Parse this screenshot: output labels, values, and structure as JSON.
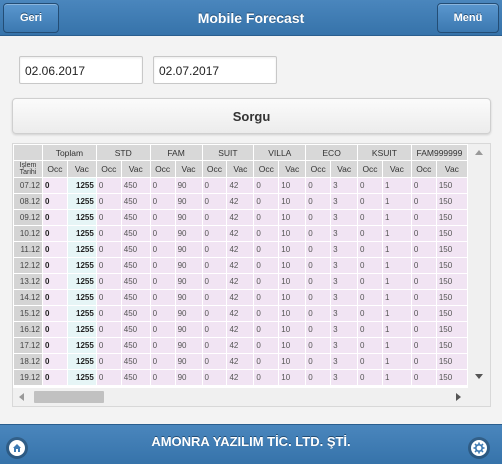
{
  "header": {
    "title": "Mobile Forecast",
    "back_label": "Geri",
    "menu_label": "Menü"
  },
  "filters": {
    "start_date": "02.06.2017",
    "end_date": "02.07.2017",
    "query_label": "Sorgu"
  },
  "grid": {
    "date_header": "İşlem Tarihi",
    "groups": [
      "Toplam",
      "STD",
      "FAM",
      "SUIT",
      "VILLA",
      "ECO",
      "KSUIT",
      "FAM999999"
    ],
    "sub_headers": [
      "Occ",
      "Vac"
    ],
    "rows": [
      {
        "date": "07.12",
        "values": [
          "0",
          "1255",
          "0",
          "450",
          "0",
          "90",
          "0",
          "42",
          "0",
          "10",
          "0",
          "3",
          "0",
          "1",
          "0",
          "150"
        ]
      },
      {
        "date": "08.12",
        "values": [
          "0",
          "1255",
          "0",
          "450",
          "0",
          "90",
          "0",
          "42",
          "0",
          "10",
          "0",
          "3",
          "0",
          "1",
          "0",
          "150"
        ]
      },
      {
        "date": "09.12",
        "values": [
          "0",
          "1255",
          "0",
          "450",
          "0",
          "90",
          "0",
          "42",
          "0",
          "10",
          "0",
          "3",
          "0",
          "1",
          "0",
          "150"
        ]
      },
      {
        "date": "10.12",
        "values": [
          "0",
          "1255",
          "0",
          "450",
          "0",
          "90",
          "0",
          "42",
          "0",
          "10",
          "0",
          "3",
          "0",
          "1",
          "0",
          "150"
        ]
      },
      {
        "date": "11.12",
        "values": [
          "0",
          "1255",
          "0",
          "450",
          "0",
          "90",
          "0",
          "42",
          "0",
          "10",
          "0",
          "3",
          "0",
          "1",
          "0",
          "150"
        ]
      },
      {
        "date": "12.12",
        "values": [
          "0",
          "1255",
          "0",
          "450",
          "0",
          "90",
          "0",
          "42",
          "0",
          "10",
          "0",
          "3",
          "0",
          "1",
          "0",
          "150"
        ]
      },
      {
        "date": "13.12",
        "values": [
          "0",
          "1255",
          "0",
          "450",
          "0",
          "90",
          "0",
          "42",
          "0",
          "10",
          "0",
          "3",
          "0",
          "1",
          "0",
          "150"
        ]
      },
      {
        "date": "14.12",
        "values": [
          "0",
          "1255",
          "0",
          "450",
          "0",
          "90",
          "0",
          "42",
          "0",
          "10",
          "0",
          "3",
          "0",
          "1",
          "0",
          "150"
        ]
      },
      {
        "date": "15.12",
        "values": [
          "0",
          "1255",
          "0",
          "450",
          "0",
          "90",
          "0",
          "42",
          "0",
          "10",
          "0",
          "3",
          "0",
          "1",
          "0",
          "150"
        ]
      },
      {
        "date": "16.12",
        "values": [
          "0",
          "1255",
          "0",
          "450",
          "0",
          "90",
          "0",
          "42",
          "0",
          "10",
          "0",
          "3",
          "0",
          "1",
          "0",
          "150"
        ]
      },
      {
        "date": "17.12",
        "values": [
          "0",
          "1255",
          "0",
          "450",
          "0",
          "90",
          "0",
          "42",
          "0",
          "10",
          "0",
          "3",
          "0",
          "1",
          "0",
          "150"
        ]
      },
      {
        "date": "18.12",
        "values": [
          "0",
          "1255",
          "0",
          "450",
          "0",
          "90",
          "0",
          "42",
          "0",
          "10",
          "0",
          "3",
          "0",
          "1",
          "0",
          "150"
        ]
      },
      {
        "date": "19.12",
        "values": [
          "0",
          "1255",
          "0",
          "450",
          "0",
          "90",
          "0",
          "42",
          "0",
          "10",
          "0",
          "3",
          "0",
          "1",
          "0",
          "150"
        ]
      }
    ]
  },
  "footer": {
    "company": "AMONRA YAZILIM TİC. LTD. ŞTİ.",
    "home_icon": "home-icon",
    "settings_icon": "gear-icon"
  },
  "colors": {
    "bar": "#3d7ab3",
    "occ_cell": "#f4e8f6",
    "vac_cell": "#e6f5f6"
  }
}
